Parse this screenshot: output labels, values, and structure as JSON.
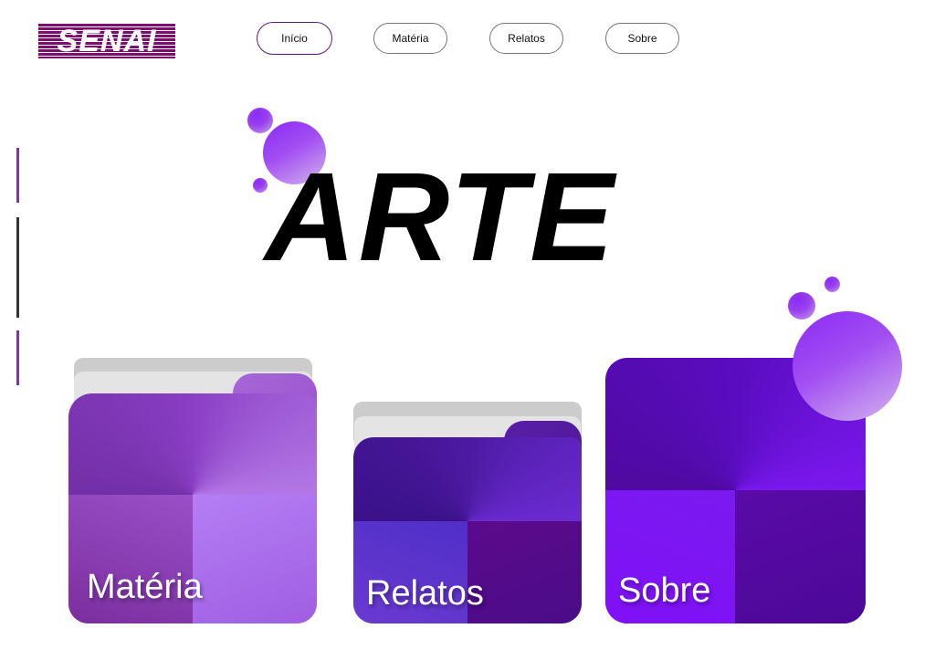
{
  "header": {
    "logo_text": "SENAI",
    "nav": [
      {
        "label": "Início",
        "active": true
      },
      {
        "label": "Matéria",
        "active": false
      },
      {
        "label": "Relatos",
        "active": false
      },
      {
        "label": "Sobre",
        "active": false
      }
    ]
  },
  "hero": {
    "title": "ARTE"
  },
  "cards": [
    {
      "label": "Matéria"
    },
    {
      "label": "Relatos"
    },
    {
      "label": "Sobre"
    }
  ],
  "colors": {
    "brand": "#7a0f6f",
    "accent": "#8a2cf5",
    "nav_active_border": "#5b1c82"
  }
}
